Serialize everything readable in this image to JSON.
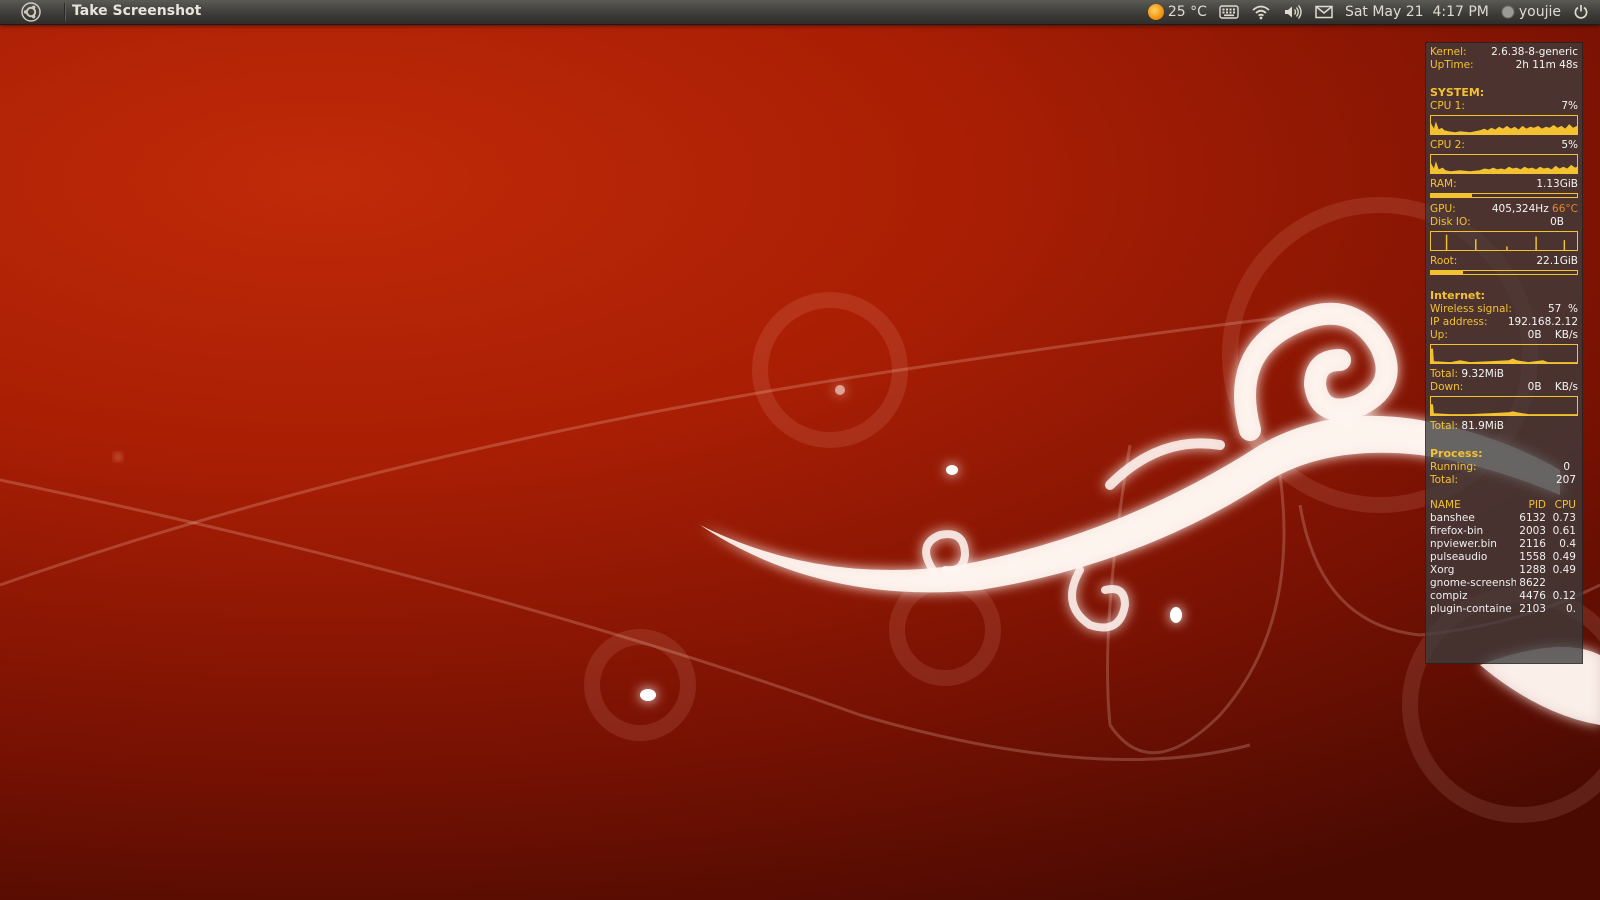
{
  "panel": {
    "app_title": "Take Screenshot",
    "weather_temp": "25 °C",
    "datetime": "Sat May 21  4:17 PM",
    "user": "youjie"
  },
  "conky": {
    "kernel_label": "Kernel:",
    "kernel_value": "2.6.38-8-generic",
    "uptime_label": "UpTime:",
    "uptime_value": "2h 11m 48s",
    "system_head": "SYSTEM:",
    "cpu1_label": "CPU 1:",
    "cpu1_value": "7%",
    "cpu1_percent": 7,
    "cpu2_label": "CPU 2:",
    "cpu2_value": "5%",
    "cpu2_percent": 5,
    "ram_label": "RAM:",
    "ram_value": "1.13GiB",
    "ram_fraction": 0.28,
    "gpu_label": "GPU:",
    "gpu_value": "405,324Hz",
    "gpu_temp": "66°C",
    "disk_label": "Disk IO:",
    "disk_value": "0B",
    "root_label": "Root:",
    "root_value": "22.1GiB",
    "root_fraction": 0.22,
    "internet_head": "Internet:",
    "wireless_label": "Wireless signal:",
    "wireless_value": "57  %",
    "ip_label": "IP address:",
    "ip_value": "192.168.2.12",
    "up_label": "Up:",
    "up_value": "0B    KB/s",
    "up_total_label": "Total:",
    "up_total_value": "9.32MiB",
    "down_label": "Down:",
    "down_value": "0B    KB/s",
    "down_total_label": "Total:",
    "down_total_value": "81.9MiB",
    "process_head": "Process:",
    "running_label": "Running:",
    "running_value": "0",
    "total_label": "Total:",
    "total_value": "207",
    "proc_headers": [
      "NAME",
      "PID",
      "CPU"
    ],
    "processes": [
      {
        "name": "banshee",
        "pid": "6132",
        "cpu": "0.73"
      },
      {
        "name": "firefox-bin",
        "pid": "2003",
        "cpu": "0.61"
      },
      {
        "name": "npviewer.bin",
        "pid": "2116",
        "cpu": "0.4"
      },
      {
        "name": "pulseaudio",
        "pid": "1558",
        "cpu": "0.49"
      },
      {
        "name": "Xorg",
        "pid": "1288",
        "cpu": "0.49"
      },
      {
        "name": "gnome-screensho",
        "pid": "8622",
        "cpu": ""
      },
      {
        "name": "compiz",
        "pid": "4476",
        "cpu": "0.12"
      },
      {
        "name": "plugin-containe",
        "pid": "2103",
        "cpu": "0."
      }
    ]
  },
  "colors": {
    "accent": "#f2c230",
    "panel": "#3c3b37",
    "wallpaper": "#a81e04"
  },
  "icons": {
    "logo": "ubuntu-logo-icon",
    "weather": "sun-icon",
    "keyboard": "keyboard-icon",
    "network": "wifi-icon",
    "sound": "volume-icon",
    "mail": "envelope-icon",
    "user": "user-status-icon",
    "session": "power-icon"
  }
}
